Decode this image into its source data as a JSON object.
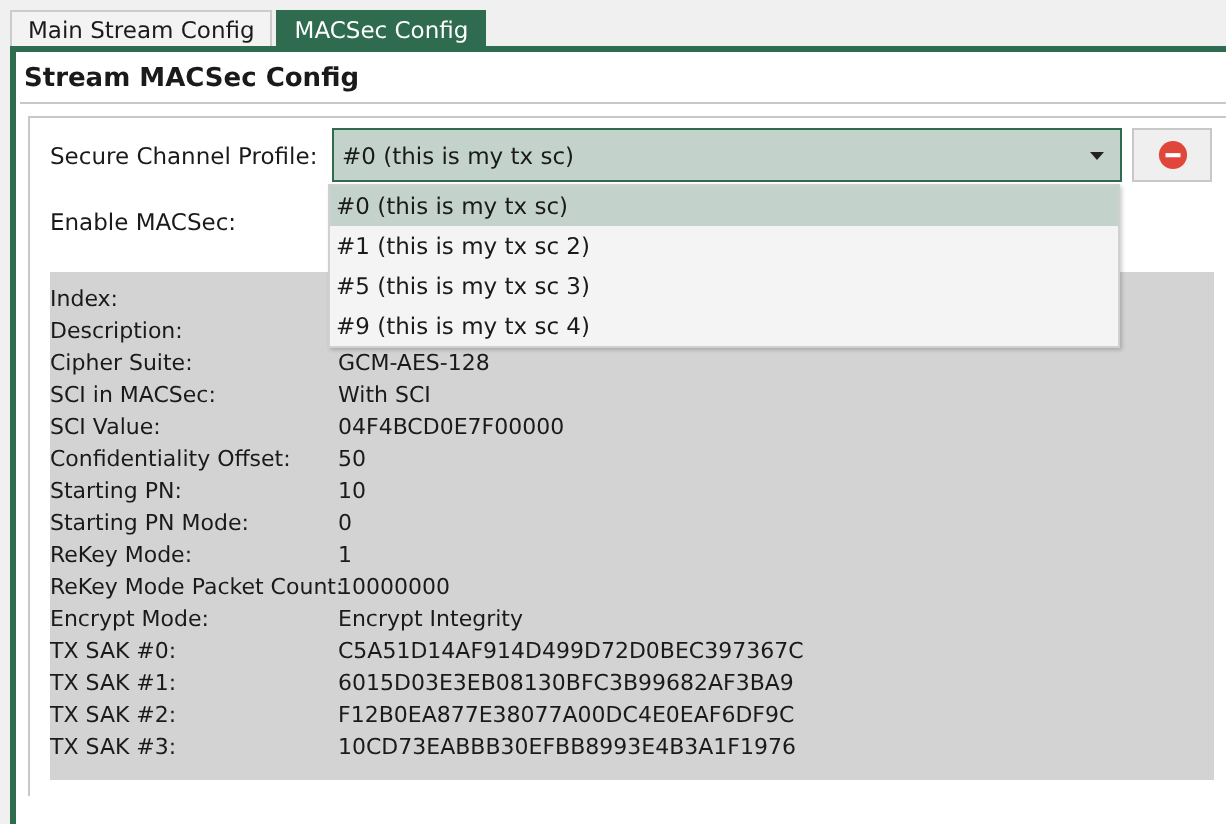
{
  "tabs": [
    {
      "label": "Main Stream Config",
      "selected": false
    },
    {
      "label": "MACSec Config",
      "selected": true
    }
  ],
  "section_title": "Stream MACSec Config",
  "profile": {
    "label": "Secure Channel Profile:",
    "value": "#0 (this is my tx sc)",
    "expanded": true,
    "options": [
      {
        "label": "#0 (this is my tx sc)",
        "selected": true
      },
      {
        "label": "#1 (this is my tx sc 2)",
        "selected": false
      },
      {
        "label": "#5 (this is my tx sc 3)",
        "selected": false
      },
      {
        "label": "#9 (this is my tx sc 4)",
        "selected": false
      }
    ]
  },
  "enable_label": "Enable MACSec:",
  "details": [
    {
      "label": "Index:"
    },
    {
      "label": "Description:"
    },
    {
      "label": "Cipher Suite:",
      "value": "GCM-AES-128"
    },
    {
      "label": "SCI in MACSec:",
      "value": "With SCI"
    },
    {
      "label": "SCI Value:",
      "value": "04F4BCD0E7F00000"
    },
    {
      "label": "Confidentiality Offset:",
      "value": "50"
    },
    {
      "label": "Starting PN:",
      "value": "10"
    },
    {
      "label": "Starting PN Mode:",
      "value": "0"
    },
    {
      "label": "ReKey Mode:",
      "value": "1"
    },
    {
      "label": "ReKey Mode Packet Count:",
      "value": "10000000"
    },
    {
      "label": "Encrypt Mode:",
      "value": "Encrypt Integrity"
    },
    {
      "label": "TX SAK #0:",
      "value": "C5A51D14AF914D499D72D0BEC397367C"
    },
    {
      "label": "TX SAK #1:",
      "value": "6015D03E3EB08130BFC3B99682AF3BA9"
    },
    {
      "label": "TX SAK #2:",
      "value": "F12B0EA877E38077A00DC4E0EAF6DF9C"
    },
    {
      "label": "TX SAK #3:",
      "value": "10CD73EABBB30EFBB8993E4B3A1F1976"
    }
  ]
}
